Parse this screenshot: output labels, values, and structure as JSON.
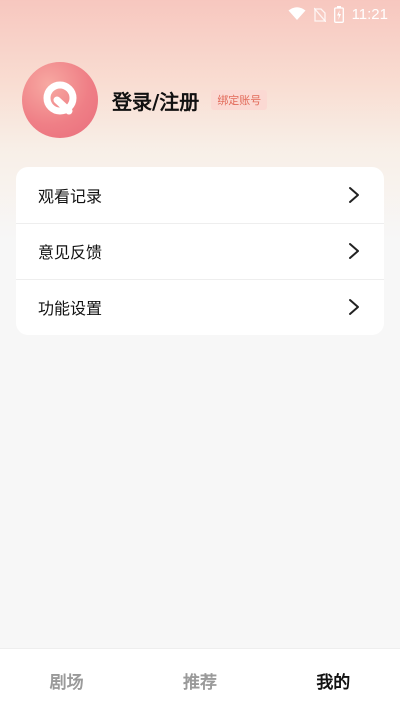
{
  "status_bar": {
    "time": "11:21",
    "icons": [
      "wifi-icon",
      "no-sim-icon",
      "battery-icon"
    ]
  },
  "profile": {
    "avatar_icon": "app-logo-icon",
    "login_label": "登录/注册",
    "bind_badge": "绑定账号"
  },
  "menu": {
    "items": [
      {
        "label": "观看记录",
        "icon": "chevron-right-icon"
      },
      {
        "label": "意见反馈",
        "icon": "chevron-right-icon"
      },
      {
        "label": "功能设置",
        "icon": "chevron-right-icon"
      }
    ]
  },
  "bottom_nav": {
    "items": [
      {
        "label": "剧场",
        "active": false
      },
      {
        "label": "推荐",
        "active": false
      },
      {
        "label": "我的",
        "active": true
      }
    ]
  },
  "colors": {
    "accent": "#e96d7c",
    "badge_text": "#e26a5a",
    "badge_bg": "#fbd9d3",
    "inactive_tab": "#9a9a9a",
    "active_tab": "#111111"
  }
}
